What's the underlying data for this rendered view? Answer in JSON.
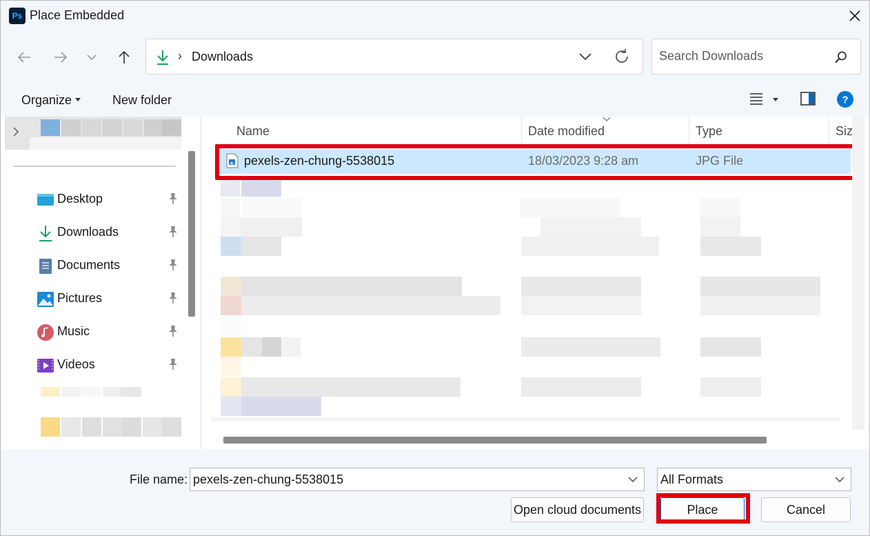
{
  "window": {
    "title": "Place Embedded",
    "app_icon_text": "Ps",
    "app_icon": "photoshop-icon"
  },
  "address": {
    "separator": "›",
    "location": "Downloads",
    "search_placeholder": "Search Downloads"
  },
  "toolbar": {
    "organize_label": "Organize",
    "new_folder_label": "New folder"
  },
  "nav": {
    "items": [
      {
        "label": "Desktop",
        "icon": "desktop-icon"
      },
      {
        "label": "Downloads",
        "icon": "download-icon"
      },
      {
        "label": "Documents",
        "icon": "documents-icon"
      },
      {
        "label": "Pictures",
        "icon": "pictures-icon"
      },
      {
        "label": "Music",
        "icon": "music-icon"
      },
      {
        "label": "Videos",
        "icon": "videos-icon"
      }
    ]
  },
  "file_list": {
    "columns": [
      "Name",
      "Date modified",
      "Type",
      "Size"
    ],
    "rows": [
      {
        "name": "pexels-zen-chung-5538015",
        "date": "18/03/2023 9:28 am",
        "type": "JPG File",
        "icon": "image-file-icon"
      }
    ]
  },
  "bottom": {
    "file_name_label": "File name:",
    "file_name_value": "pexels-zen-chung-5538015",
    "format_value": "All Formats",
    "open_cloud_label": "Open cloud documents",
    "place_label": "Place",
    "cancel_label": "Cancel"
  },
  "colors": {
    "highlight": "#e00012",
    "selection": "#cce8ff",
    "chrome": "#f3f6fb",
    "accent": "#0067c0"
  }
}
